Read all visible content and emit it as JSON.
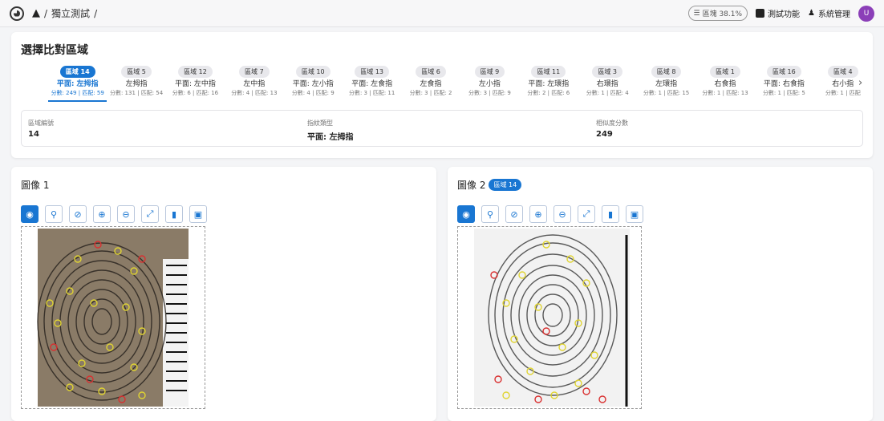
{
  "breadcrumb": {
    "item": "獨立測試"
  },
  "topbar": {
    "ratio_label": "區塊 38.1%",
    "test_label": "測試功能",
    "system_label": "系統管理",
    "avatar_initial": "U"
  },
  "region_card": {
    "title": "選擇比對區域",
    "tabs": [
      {
        "chip": "區域 14",
        "name": "平面: 左拇指",
        "score": "分數: 249 | 匹配: 59",
        "active": true
      },
      {
        "chip": "區域 5",
        "name": "左拇指",
        "score": "分數: 131 | 匹配: 54"
      },
      {
        "chip": "區域 12",
        "name": "平面: 左中指",
        "score": "分數: 6 | 匹配: 16"
      },
      {
        "chip": "區域 7",
        "name": "左中指",
        "score": "分數: 4 | 匹配: 13"
      },
      {
        "chip": "區域 10",
        "name": "平面: 左小指",
        "score": "分數: 4 | 匹配: 9"
      },
      {
        "chip": "區域 13",
        "name": "平面: 左食指",
        "score": "分數: 3 | 匹配: 11"
      },
      {
        "chip": "區域 6",
        "name": "左食指",
        "score": "分數: 3 | 匹配: 2"
      },
      {
        "chip": "區域 9",
        "name": "左小指",
        "score": "分數: 3 | 匹配: 9"
      },
      {
        "chip": "區域 11",
        "name": "平面: 左環指",
        "score": "分數: 2 | 匹配: 6"
      },
      {
        "chip": "區域 3",
        "name": "右環指",
        "score": "分數: 1 | 匹配: 4"
      },
      {
        "chip": "區域 8",
        "name": "左環指",
        "score": "分數: 1 | 匹配: 15"
      },
      {
        "chip": "區域 1",
        "name": "右食指",
        "score": "分數: 1 | 匹配: 13"
      },
      {
        "chip": "區域 16",
        "name": "平面: 右食指",
        "score": "分數: 1 | 匹配: 5"
      },
      {
        "chip": "區域 4",
        "name": "右小指",
        "score": "分數: 1 | 匹配"
      }
    ],
    "info": {
      "region_label": "區域編號",
      "region_value": "14",
      "type_label": "指紋類型",
      "type_value": "平面: 左拇指",
      "score_label": "相似度分數",
      "score_value": "249"
    }
  },
  "panels": {
    "left_title": "圖像 1",
    "right_title": "圖像 2",
    "right_chip": "區域 14"
  }
}
